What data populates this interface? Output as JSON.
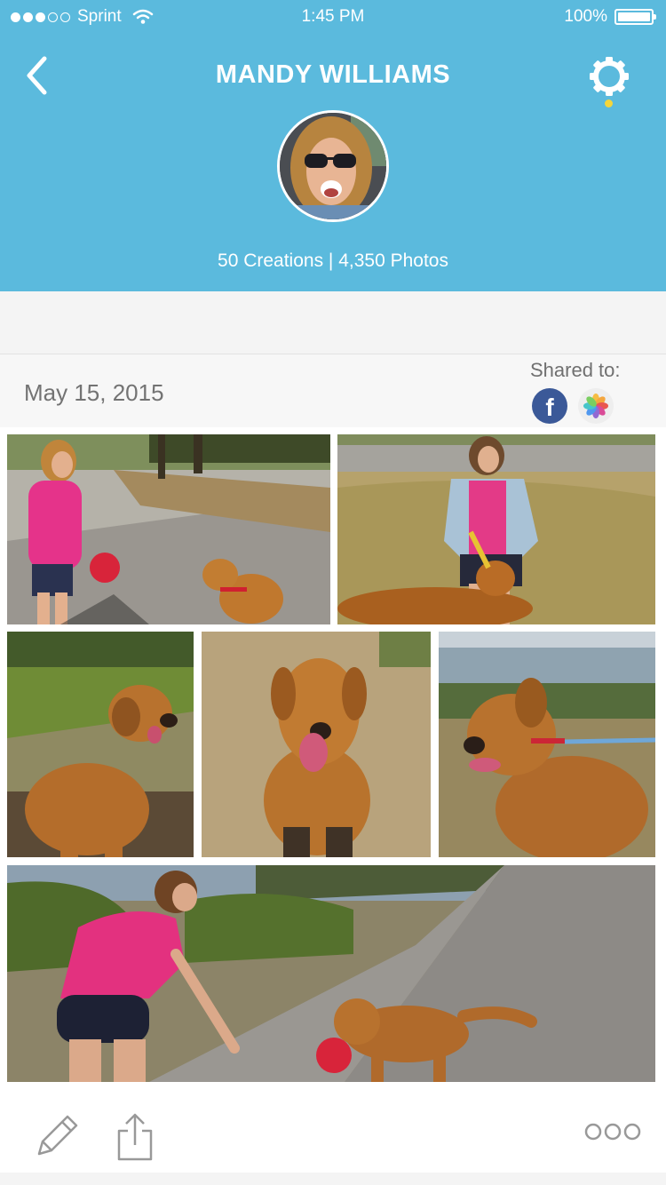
{
  "status_bar": {
    "carrier": "Sprint",
    "time": "1:45 PM",
    "battery": "100%",
    "signal_bars_filled": 3,
    "signal_bars_total": 5
  },
  "header": {
    "title": "MANDY WILLIAMS",
    "stats": "50 Creations | 4,350 Photos",
    "back_icon": "chevron-left-icon",
    "settings_icon": "gear-icon",
    "accent_color": "#5bbadd",
    "notification_dot_color": "#f4d63b"
  },
  "creation": {
    "date": "May 15, 2015",
    "shared_label": "Shared to:",
    "shared_targets": [
      {
        "name": "facebook",
        "glyph": "f",
        "color": "#3b5998"
      },
      {
        "name": "photos",
        "color": "#eeeeee"
      }
    ],
    "photos": [
      {
        "name": "photo-woman-ball-dog-park"
      },
      {
        "name": "photo-woman-denim-dog"
      },
      {
        "name": "photo-dog-grass-profile"
      },
      {
        "name": "photo-dog-sitting-front"
      },
      {
        "name": "photo-dog-waterfront-leash"
      },
      {
        "name": "photo-woman-playing-dog-path"
      }
    ]
  },
  "toolbar": {
    "edit_icon": "pencil-icon",
    "share_icon": "share-icon",
    "more_icon": "more-icon"
  }
}
